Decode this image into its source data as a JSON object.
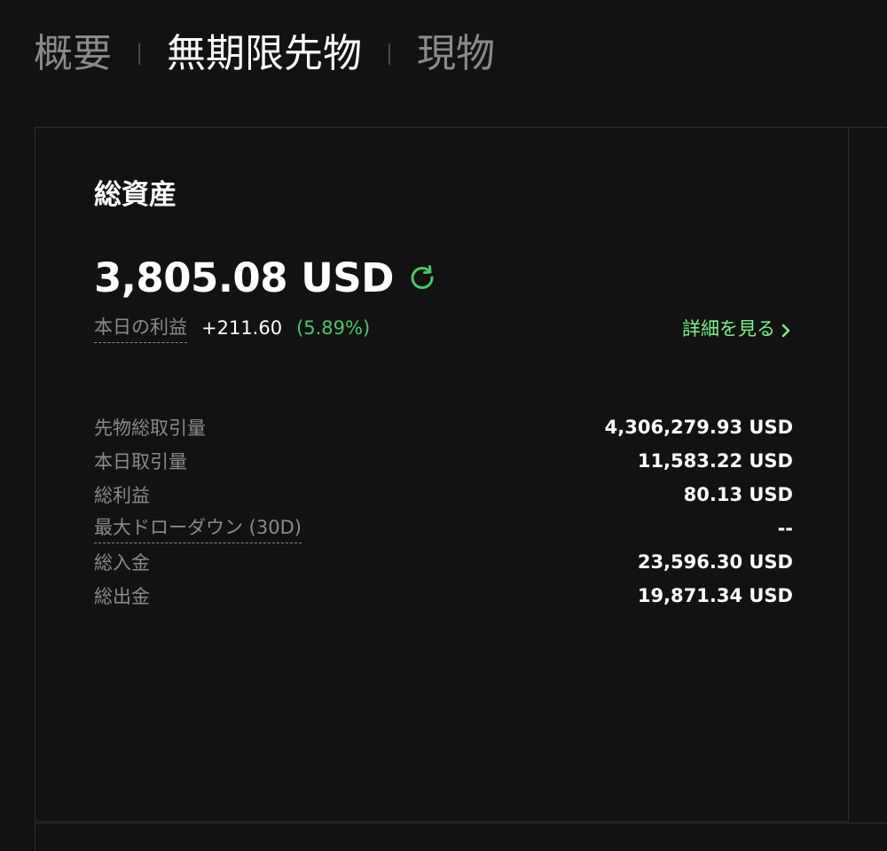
{
  "tabs": [
    {
      "label": "概要",
      "active": false
    },
    {
      "label": "無期限先物",
      "active": true
    },
    {
      "label": "現物",
      "active": false
    }
  ],
  "summary": {
    "title": "総資産",
    "balance": "3,805.08 USD",
    "refresh_icon": "refresh-icon",
    "pnl_label": "本日の利益",
    "pnl_value": "+211.60",
    "pnl_pct": "(5.89%)",
    "details_label": "詳細を見る",
    "details_icon": "chevron-right-icon"
  },
  "stats": [
    {
      "label": "先物総取引量",
      "value": "4,306,279.93 USD"
    },
    {
      "label": "本日取引量",
      "value": "11,583.22 USD"
    },
    {
      "label": "総利益",
      "value": "80.13 USD"
    },
    {
      "label": "最大ドローダウン (30D)",
      "value": "--"
    },
    {
      "label": "総入金",
      "value": "23,596.30 USD"
    },
    {
      "label": "総出金",
      "value": "19,871.34 USD"
    }
  ],
  "colors": {
    "background": "#121212",
    "accent_green": "#7cf08b",
    "pct_green": "#4cc46b",
    "muted_text": "#8a8a8a",
    "border": "#2e2e2e"
  }
}
